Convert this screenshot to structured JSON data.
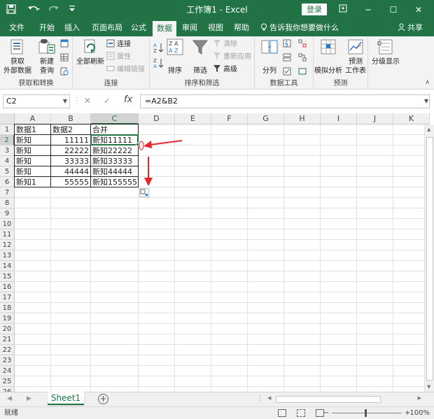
{
  "titlebar": {
    "title": "工作簿1  -  Excel",
    "login": "登录"
  },
  "tabs": [
    "文件",
    "开始",
    "插入",
    "页面布局",
    "公式",
    "数据",
    "审阅",
    "视图",
    "帮助"
  ],
  "active_tab": "数据",
  "tellme": "告诉我你想要做什么",
  "share": "共享",
  "ribbon": {
    "get_external_1": "获取",
    "get_external_2": "外部数据",
    "new_query_1": "新建",
    "new_query_2": "查询",
    "group_get_transform": "获取和转换",
    "refresh_all": "全部刷新",
    "connections": "连接",
    "properties": "属性",
    "edit_links": "编辑链接",
    "group_connections": "连接",
    "sort": "排序",
    "filter": "筛选",
    "clear": "清除",
    "reapply": "重新应用",
    "advanced": "高级",
    "group_sort_filter": "排序和筛选",
    "text_to_columns": "分列",
    "group_data_tools": "数据工具",
    "what_if": "模拟分析",
    "forecast_sheet_1": "预测",
    "forecast_sheet_2": "工作表",
    "group_forecast": "预测",
    "outline": "分级显示"
  },
  "formula_bar": {
    "name_box": "C2",
    "formula": "=A2&B2"
  },
  "columns": [
    "A",
    "B",
    "C",
    "D",
    "E",
    "F",
    "G",
    "H",
    "I",
    "J",
    "K"
  ],
  "rows": [
    "1",
    "2",
    "3",
    "4",
    "5",
    "6",
    "7",
    "8",
    "9",
    "10",
    "11",
    "12",
    "13",
    "14",
    "15",
    "16",
    "17",
    "18",
    "19",
    "20",
    "21",
    "22",
    "23",
    "24",
    "25",
    "26"
  ],
  "table": {
    "headers": [
      "数据1",
      "数据2",
      "合并"
    ],
    "data": [
      [
        "新知",
        "11111",
        "新知11111"
      ],
      [
        "新知",
        "22222",
        "新知22222"
      ],
      [
        "新知",
        "33333",
        "新知33333"
      ],
      [
        "新知",
        "44444",
        "新知44444"
      ],
      [
        "新知1",
        "55555",
        "新知155555"
      ]
    ]
  },
  "sheet_tab": "Sheet1",
  "status": {
    "ready": "就绪",
    "zoom": "100%"
  },
  "colors": {
    "accent": "#217346",
    "annotation_arrow": "#e8262b"
  }
}
